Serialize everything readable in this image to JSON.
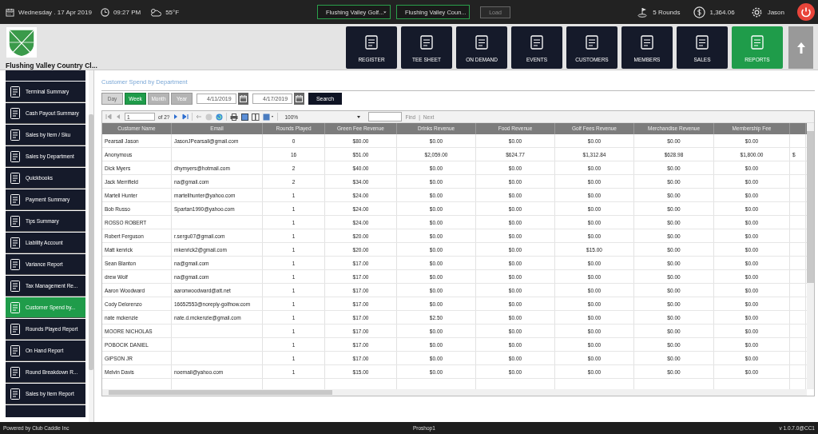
{
  "top_bar": {
    "date": "Wednesday . 17 Apr 2019",
    "time": "09:27 PM",
    "weather": "55°F",
    "course_select": "Flushing Valley Golf...",
    "club_select": "Flushing Valley Coun...",
    "load_button": {
      "label": "Load",
      "disabled": true
    },
    "rounds": "5 Rounds",
    "balance": "1,364.06",
    "user": "Jason"
  },
  "club_name": "Flushing Valley Country Cl...",
  "nav_tiles": [
    {
      "label": "REGISTER",
      "selected": false
    },
    {
      "label": "TEE SHEET",
      "selected": false
    },
    {
      "label": "ON DEMAND",
      "selected": false
    },
    {
      "label": "EVENTS",
      "selected": false
    },
    {
      "label": "CUSTOMERS",
      "selected": false
    },
    {
      "label": "MEMBERS",
      "selected": false
    },
    {
      "label": "SALES",
      "selected": false
    },
    {
      "label": "REPORTS",
      "selected": true
    }
  ],
  "sidebar": {
    "items": [
      {
        "label": "Terminal Summary",
        "selected": false
      },
      {
        "label": "Cash Payout Summary",
        "selected": false
      },
      {
        "label": "Sales by Item / Sku",
        "selected": false
      },
      {
        "label": "Sales by Department",
        "selected": false
      },
      {
        "label": "Quickbooks",
        "selected": false
      },
      {
        "label": "Payment Summary",
        "selected": false
      },
      {
        "label": "Tips Summary",
        "selected": false
      },
      {
        "label": "Liability Account",
        "selected": false
      },
      {
        "label": "Variance Report",
        "selected": false
      },
      {
        "label": "Tax Management Re...",
        "selected": false
      },
      {
        "label": "Customer Spend by...",
        "selected": true
      },
      {
        "label": "Rounds Played Report",
        "selected": false
      },
      {
        "label": "On Hand Report",
        "selected": false
      },
      {
        "label": "Round Breakdown R...",
        "selected": false
      },
      {
        "label": "Sales by Item Report",
        "selected": false
      }
    ]
  },
  "report": {
    "title": "Customer Spend by Department",
    "period_buttons": [
      {
        "label": "Day",
        "selected": false,
        "disabled": true
      },
      {
        "label": "Week",
        "selected": true,
        "disabled": false
      },
      {
        "label": "Month",
        "selected": false,
        "disabled": false
      },
      {
        "label": "Year",
        "selected": false,
        "disabled": false
      }
    ],
    "start_date": "4/11/2019",
    "end_date": "4/17/2019",
    "search_button": "Search",
    "toolbar": {
      "page": "1",
      "page_count": "of 2?",
      "zoom": "100%",
      "find": "Find",
      "separator": "|",
      "next": "Next"
    },
    "columns": [
      "Customer Name",
      "Email",
      "Rounds Played",
      "Green Fee Revenue",
      "Drinks Revenue",
      "Food Revenue",
      "Golf Fees Revenue",
      "Merchandise Revenue",
      "Membership Fee"
    ],
    "rows": [
      [
        "Pearsall Jason",
        "JasonJPearsall@gmail.com",
        "0",
        "$80.00",
        "$0.00",
        "$0.00",
        "$0.00",
        "$0.00",
        "$0.00"
      ],
      [
        "Anonymous",
        "",
        "16",
        "$51.00",
        "$2,059.00",
        "$624.77",
        "$1,312.84",
        "$628.98",
        "$1,800.00",
        "$"
      ],
      [
        "Dick Myers",
        "dhymyers@hotmail.com",
        "2",
        "$40.00",
        "$0.00",
        "$0.00",
        "$0.00",
        "$0.00",
        "$0.00"
      ],
      [
        "Jack Merrifield",
        "na@gmail.com",
        "2",
        "$34.00",
        "$0.00",
        "$0.00",
        "$0.00",
        "$0.00",
        "$0.00"
      ],
      [
        "Martell Hunter",
        "martellhunter@yahoo.com",
        "1",
        "$24.00",
        "$0.00",
        "$0.00",
        "$0.00",
        "$0.00",
        "$0.00"
      ],
      [
        "Bob Russo",
        "Spartan1990@yahoo.com",
        "1",
        "$24.00",
        "$0.00",
        "$0.00",
        "$0.00",
        "$0.00",
        "$0.00"
      ],
      [
        "ROSSO ROBERT",
        "",
        "1",
        "$24.00",
        "$0.00",
        "$0.00",
        "$0.00",
        "$0.00",
        "$0.00"
      ],
      [
        "Robert Ferguson",
        "r.sergu07@gmail.com",
        "1",
        "$20.00",
        "$0.00",
        "$0.00",
        "$0.00",
        "$0.00",
        "$0.00"
      ],
      [
        "Matt kenrick",
        "mkenrick2@gmail.com",
        "1",
        "$20.00",
        "$0.00",
        "$0.00",
        "$15.00",
        "$0.00",
        "$0.00"
      ],
      [
        "Sean Blanton",
        "na@gmail.com",
        "1",
        "$17.00",
        "$0.00",
        "$0.00",
        "$0.00",
        "$0.00",
        "$0.00"
      ],
      [
        "drew Wolf",
        "na@gmail.com",
        "1",
        "$17.00",
        "$0.00",
        "$0.00",
        "$0.00",
        "$0.00",
        "$0.00"
      ],
      [
        "Aaron Woodward",
        "aaronwoodward@att.net",
        "1",
        "$17.00",
        "$0.00",
        "$0.00",
        "$0.00",
        "$0.00",
        "$0.00"
      ],
      [
        "Cody Delorenzo",
        "16652553@noreply-golfnow.com",
        "1",
        "$17.00",
        "$0.00",
        "$0.00",
        "$0.00",
        "$0.00",
        "$0.00"
      ],
      [
        "nate mckenzie",
        "nate.d.mckenzie@gmail.com",
        "1",
        "$17.00",
        "$2.50",
        "$0.00",
        "$0.00",
        "$0.00",
        "$0.00"
      ],
      [
        "MOORE NICHOLAS",
        "",
        "1",
        "$17.00",
        "$0.00",
        "$0.00",
        "$0.00",
        "$0.00",
        "$0.00"
      ],
      [
        "POBOCIK DANIEL",
        "",
        "1",
        "$17.00",
        "$0.00",
        "$0.00",
        "$0.00",
        "$0.00",
        "$0.00"
      ],
      [
        "GIPSON JR",
        "",
        "1",
        "$17.00",
        "$0.00",
        "$0.00",
        "$0.00",
        "$0.00",
        "$0.00"
      ],
      [
        "Melvin Davis",
        "noemail@yahoo.com",
        "1",
        "$15.00",
        "$0.00",
        "$0.00",
        "$0.00",
        "$0.00",
        "$0.00"
      ]
    ]
  },
  "status_bar": {
    "left": "Powered by Club Caddie Inc",
    "center": "Proshop1",
    "right": "v 1.0.7.0@CC1"
  }
}
